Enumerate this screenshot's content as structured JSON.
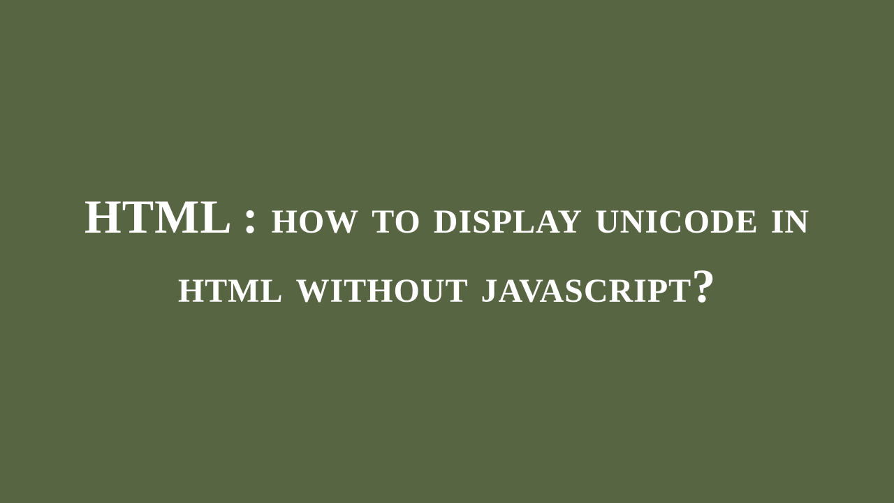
{
  "title": {
    "prefix": "HTML : ",
    "restText": "how to display unicode in html without javascript?"
  },
  "colors": {
    "background": "#586543",
    "text": "#ffffff"
  }
}
